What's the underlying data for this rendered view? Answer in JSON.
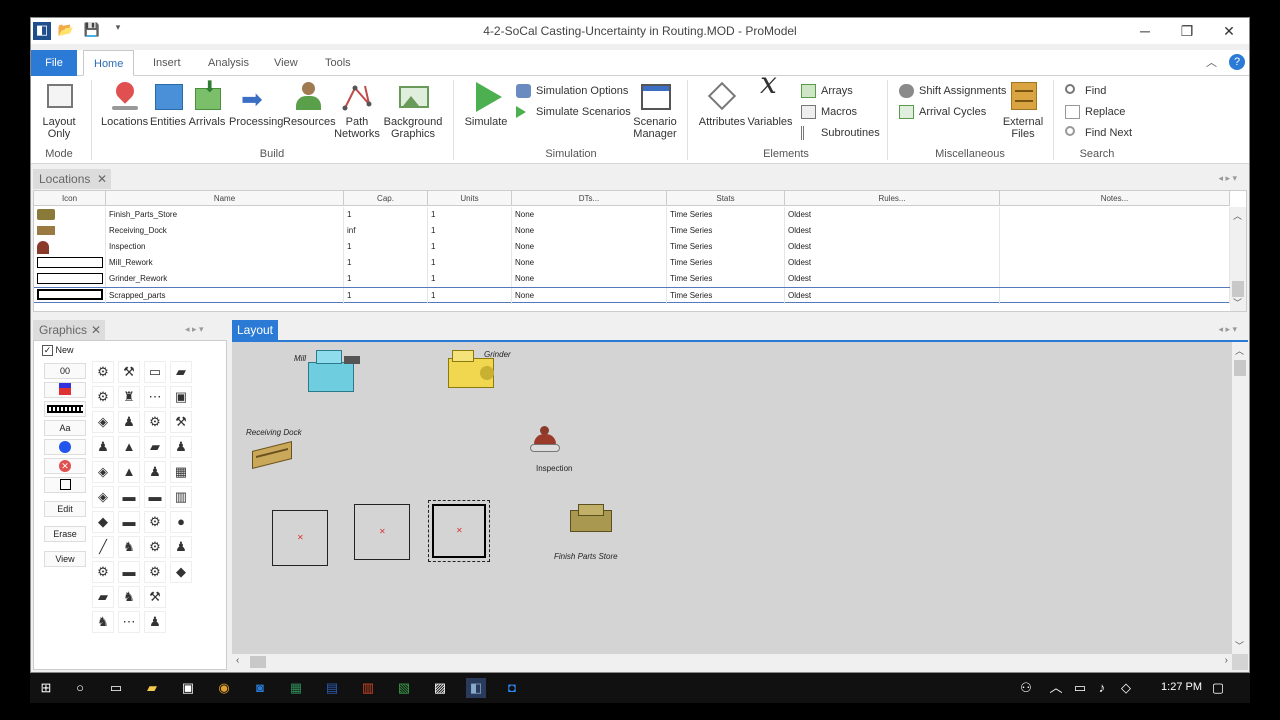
{
  "window": {
    "title": "4-2-SoCal Casting-Uncertainty in Routing.MOD - ProModel"
  },
  "ribbon_tabs": [
    "File",
    "Home",
    "Insert",
    "Analysis",
    "View",
    "Tools"
  ],
  "ribbon": {
    "mode": {
      "label": "Mode",
      "layout_only": "Layout Only"
    },
    "build": {
      "label": "Build",
      "items": [
        "Locations",
        "Entities",
        "Arrivals",
        "Processing",
        "Resources",
        "Path Networks",
        "Background Graphics"
      ]
    },
    "simulation": {
      "label": "Simulation",
      "simulate": "Simulate",
      "options": "Simulation Options",
      "scenarios": "Simulate Scenarios",
      "scenario_manager": "Scenario Manager"
    },
    "elements": {
      "label": "Elements",
      "attributes": "Attributes",
      "variables": "Variables",
      "arrays": "Arrays",
      "macros": "Macros",
      "subroutines": "Subroutines"
    },
    "misc": {
      "label": "Miscellaneous",
      "shift": "Shift Assignments",
      "arrival_cycles": "Arrival Cycles",
      "external_files": "External Files"
    },
    "search": {
      "label": "Search",
      "find": "Find",
      "replace": "Replace",
      "find_next": "Find Next"
    }
  },
  "locations": {
    "tab": "Locations",
    "columns": [
      "Icon",
      "Name",
      "Cap.",
      "Units",
      "DTs...",
      "Stats",
      "Rules...",
      "Notes..."
    ],
    "rows": [
      {
        "name": "Finish_Parts_Store",
        "cap": "1",
        "units": "1",
        "dts": "None",
        "stats": "Time Series",
        "rules": "Oldest"
      },
      {
        "name": "Receiving_Dock",
        "cap": "inf",
        "units": "1",
        "dts": "None",
        "stats": "Time Series",
        "rules": "Oldest"
      },
      {
        "name": "Inspection",
        "cap": "1",
        "units": "1",
        "dts": "None",
        "stats": "Time Series",
        "rules": "Oldest"
      },
      {
        "name": "Mill_Rework",
        "cap": "1",
        "units": "1",
        "dts": "None",
        "stats": "Time Series",
        "rules": "Oldest"
      },
      {
        "name": "Grinder_Rework",
        "cap": "1",
        "units": "1",
        "dts": "None",
        "stats": "Time Series",
        "rules": "Oldest"
      },
      {
        "name": "Scrapped_parts",
        "cap": "1",
        "units": "1",
        "dts": "None",
        "stats": "Time Series",
        "rules": "Oldest"
      }
    ]
  },
  "graphics": {
    "tab": "Graphics",
    "new_label": "New",
    "tool_00": "00",
    "tool_aa": "Aa",
    "edit": "Edit",
    "erase": "Erase",
    "view": "View"
  },
  "layout": {
    "tab": "Layout",
    "labels": {
      "mill": "Mill",
      "grinder": "Grinder",
      "receiving": "Receiving Dock",
      "inspection": "Inspection",
      "finish": "Finish Parts Store"
    }
  },
  "taskbar": {
    "time": "1:27 PM"
  }
}
